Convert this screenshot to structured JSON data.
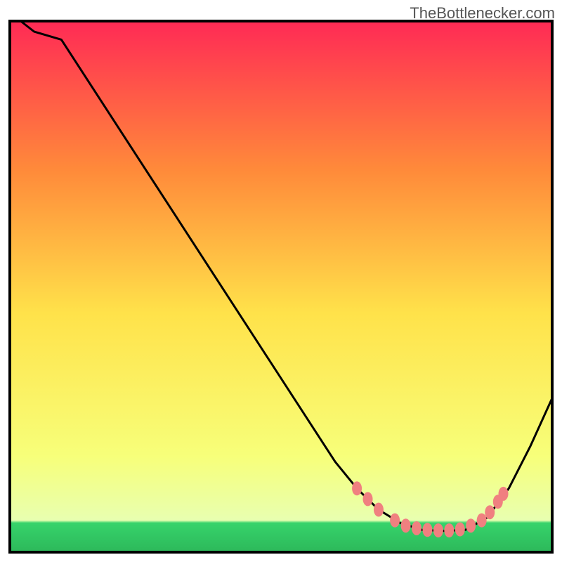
{
  "watermark": "TheBottlenecker.com",
  "chart_data": {
    "type": "line",
    "title": "",
    "xlabel": "",
    "ylabel": "",
    "xlim": [
      0,
      100
    ],
    "ylim": [
      0,
      100
    ],
    "gradient_colors": {
      "top": "#ff2a55",
      "upper_mid": "#ff8a3a",
      "mid": "#ffe24a",
      "lower_mid": "#f7ff7a",
      "bottom_band": "#36d36b",
      "bottom_edge": "#2db85a"
    },
    "curve_points": [
      {
        "x": 2,
        "y": 100
      },
      {
        "x": 4.5,
        "y": 98
      },
      {
        "x": 9.5,
        "y": 96.5
      },
      {
        "x": 60,
        "y": 17
      },
      {
        "x": 64,
        "y": 12
      },
      {
        "x": 68,
        "y": 8
      },
      {
        "x": 72,
        "y": 5.5
      },
      {
        "x": 76,
        "y": 4.2
      },
      {
        "x": 80,
        "y": 4.0
      },
      {
        "x": 84,
        "y": 4.2
      },
      {
        "x": 88,
        "y": 6.5
      },
      {
        "x": 92,
        "y": 12
      },
      {
        "x": 96,
        "y": 20
      },
      {
        "x": 100,
        "y": 29
      }
    ],
    "markers": [
      {
        "x": 64,
        "y": 12
      },
      {
        "x": 66,
        "y": 10
      },
      {
        "x": 68,
        "y": 8
      },
      {
        "x": 71,
        "y": 6
      },
      {
        "x": 73,
        "y": 5
      },
      {
        "x": 75,
        "y": 4.5
      },
      {
        "x": 77,
        "y": 4.2
      },
      {
        "x": 79,
        "y": 4.1
      },
      {
        "x": 81,
        "y": 4.1
      },
      {
        "x": 83,
        "y": 4.3
      },
      {
        "x": 85,
        "y": 5
      },
      {
        "x": 87,
        "y": 6
      },
      {
        "x": 88.5,
        "y": 7.5
      },
      {
        "x": 90,
        "y": 9.5
      },
      {
        "x": 91,
        "y": 11
      }
    ],
    "marker_color": "#f08080",
    "line_color": "#000000",
    "frame_color": "#000000"
  }
}
